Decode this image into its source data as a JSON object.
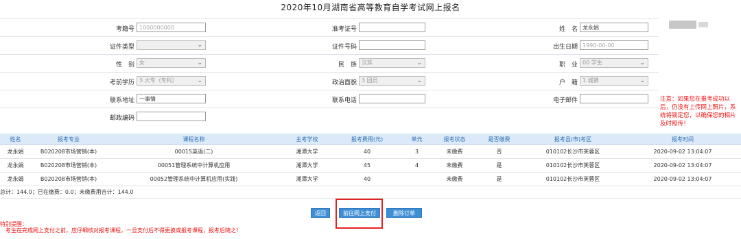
{
  "page_title": "2020年10月湖南省高等教育自学考试网上报名",
  "form": {
    "r1": {
      "kaosheng_label": "考籍号",
      "kaosheng_value": "1000000000",
      "zhunkao_label": "准考证号",
      "zhunkao_value": "",
      "name_label": "姓　名",
      "name_value": "龙永娟"
    },
    "r2": {
      "doctype_label": "证件类型",
      "doctype_value": "",
      "docno_label": "证件号码",
      "docno_value": "",
      "birth_label": "出生日期",
      "birth_value": "1990-00-00"
    },
    "r3": {
      "gender_label": "性　别",
      "gender_value": "女",
      "nation_label": "民　族",
      "nation_value": "汉族",
      "job_label": "职　业",
      "job_value": "00 学生"
    },
    "r4": {
      "exammode_label": "考前学历",
      "exammode_value": "3 大专（专科）",
      "politics_label": "政治面貌",
      "politics_value": "3 团员",
      "hukou_label": "户　籍",
      "hukou_value": "1 城镇"
    },
    "r5": {
      "contact_label": "联系地址",
      "contact_value": "一事情",
      "phone_label": "联系电话",
      "phone_value": "",
      "email_label": "电子邮件",
      "email_value": ""
    },
    "r6": {
      "postcode_label": "邮政编码",
      "postcode_value": ""
    }
  },
  "note": "注意：如果您在报考成功以后，仍没有上传网上照片，系统将锁定您，以确保您的相片及时照传！",
  "table": {
    "headers": [
      "姓名",
      "报考专业",
      "课程名称",
      "主考学校",
      "报考费用(元)",
      "单元",
      "报考状态",
      "是否缴费",
      "报考县(市)考区",
      "报考时间"
    ],
    "rows": [
      [
        "龙永娟",
        "B020208市场营销(本)",
        "00015英语(二)",
        "湘潭大学",
        "40",
        "3",
        "未缴费",
        "否",
        "010102长沙市芙蓉区",
        "2020-09-02 13:04:07"
      ],
      [
        "龙永娟",
        "B020208市场营销(本)",
        "00051管理系统中计算机应用",
        "湘潭大学",
        "45",
        "4",
        "未缴费",
        "是",
        "010102长沙市芙蓉区",
        "2020-09-02 13:04:07"
      ],
      [
        "龙永娟",
        "B020208市场营销(本)",
        "00052管理系统中计算机应用(实践)",
        "湘潭大学",
        "40",
        "",
        "未缴费",
        "是",
        "010102长沙市芙蓉区",
        "2020-09-02 13:04:07"
      ]
    ]
  },
  "summary": "总计：144.0；已在缴费：0.0；未缴费用合计：144.0",
  "buttons": {
    "back": "返回",
    "pay": "前往网上支付",
    "delete": "删除订单"
  },
  "warning": {
    "heading": "特别提醒：",
    "body": "考生在完成网上支付之前，应仔细核对报考课程，一旦支付后不得更换或报考课程，报考后随之！"
  },
  "colors": {
    "header_bg": "#dbe9f8",
    "header_text": "#2a6db5",
    "button_bg": "#3f8fd6",
    "warn": "#ee1111",
    "highlight": "#e52222"
  }
}
